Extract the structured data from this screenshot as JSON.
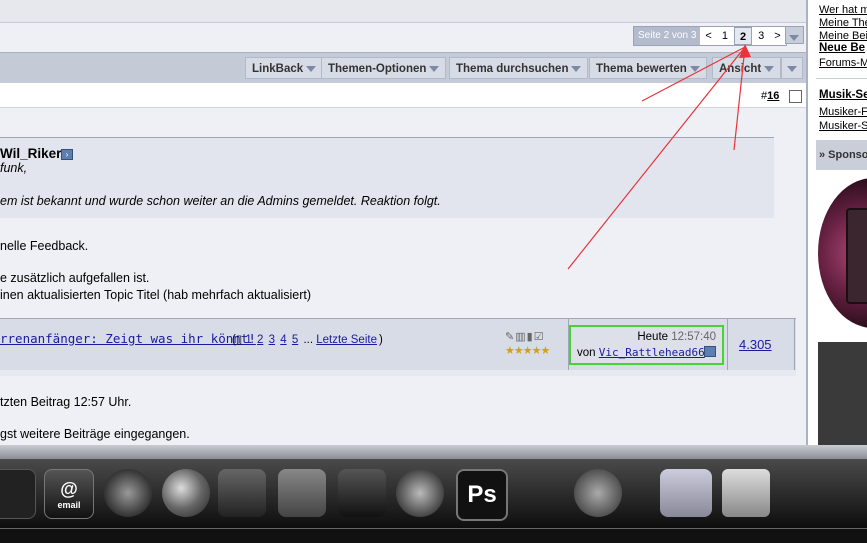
{
  "pagination": {
    "info": "Seite 2 von 3",
    "prev": "<",
    "pages": [
      "1",
      "2",
      "3"
    ],
    "current": "2",
    "next": ">"
  },
  "toolbar": {
    "linkback": "LinkBack",
    "themen_optionen": "Themen-Optionen",
    "thema_durchsuchen": "Thema durchsuchen",
    "thema_bewerten": "Thema bewerten",
    "ansicht": "Ansicht"
  },
  "post": {
    "number_prefix": "#",
    "number": "16",
    "quote_author": "Wil_Riker",
    "quote_line1": "funk,",
    "quote_line2": "em ist bekannt und wurde schon weiter an die Admins gemeldet. Reaktion folgt.",
    "line1": "nelle Feedback.",
    "line2": "e zusätzlich aufgefallen ist.",
    "line3": "inen aktualisierten Topic Titel (hab mehrfach aktualisiert)"
  },
  "thread": {
    "title": "rrenanfänger: Zeigt was ihr könnt!",
    "pages_open": "(",
    "pages": [
      "1",
      "2",
      "3",
      "4",
      "5"
    ],
    "ellipsis": "...",
    "last_page": "Letzte Seite",
    "pages_close": ")",
    "stars": "★★★★★",
    "last_post_date": "Heute",
    "last_post_time": "12:57:40",
    "last_post_by": "von",
    "last_post_user": "Vic_Rattlehead66",
    "replies": "4.305"
  },
  "below": {
    "line1": "tzten Beitrag 12:57 Uhr.",
    "line2": "gst weitere Beiträge eingegangen."
  },
  "sidebar": {
    "links": [
      "Wer hat m",
      "Meine The",
      "Meine Beit"
    ],
    "bold1": "Neue Be",
    "link2": "Forums-M",
    "bold2": "Musik-Se",
    "links2": [
      "Musiker-F",
      "Musiker-S"
    ],
    "sponsor": "» Sponso"
  },
  "dock": {
    "email_label": "email",
    "ps_label": "Ps"
  },
  "colors": {
    "highlight": "#48d234",
    "annotation_arrows": "#e8343a"
  }
}
